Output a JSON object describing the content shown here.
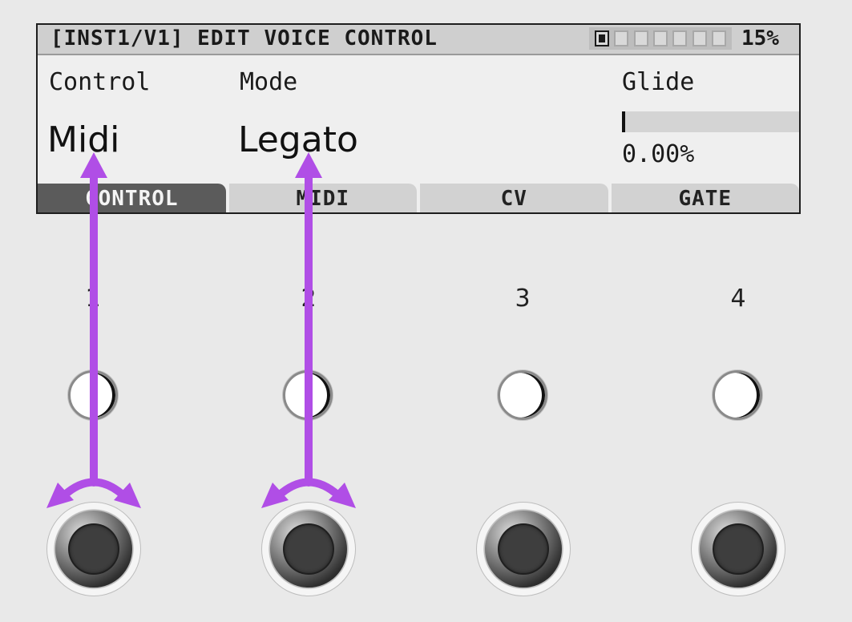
{
  "screen": {
    "title": "[INST1/V1] EDIT VOICE CONTROL",
    "cpu": "15%",
    "preset_slots": {
      "count": 7,
      "active_index": 0
    },
    "params": [
      {
        "label": "Control",
        "value": "Midi"
      },
      {
        "label": "Mode",
        "value": "Legato"
      }
    ],
    "glide": {
      "label": "Glide",
      "value": "0.00%",
      "level": 0.0
    },
    "tabs": [
      {
        "label": "CONTROL",
        "active": true
      },
      {
        "label": "MIDI",
        "active": false
      },
      {
        "label": "CV",
        "active": false
      },
      {
        "label": "GATE",
        "active": false
      }
    ]
  },
  "controls": [
    {
      "number": "1"
    },
    {
      "number": "2"
    },
    {
      "number": "3"
    },
    {
      "number": "4"
    }
  ],
  "annotations": {
    "arrow_color": "#b04ee6"
  }
}
